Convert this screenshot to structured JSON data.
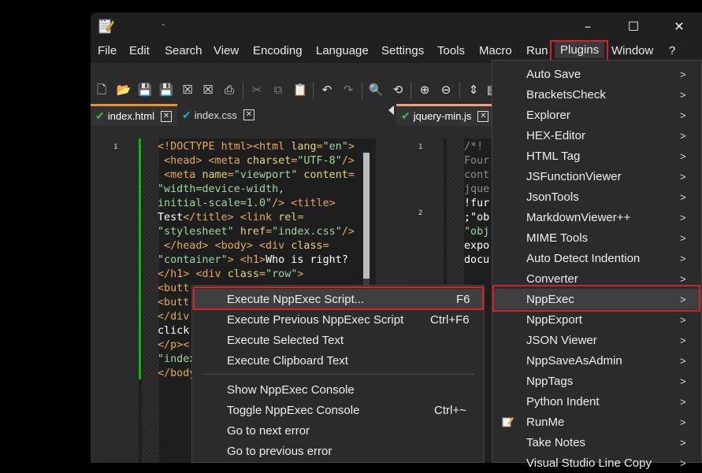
{
  "menubar": {
    "items": [
      "File",
      "Edit",
      "Search",
      "View",
      "Encoding",
      "Language",
      "Settings",
      "Tools",
      "Macro",
      "Run",
      "Plugins",
      "Window",
      "?"
    ],
    "title_fragment": "-"
  },
  "window_controls": {
    "minimize": "–",
    "maximize": "☐",
    "close": "✕"
  },
  "tabs_left": [
    {
      "label": "index.html",
      "active": true
    },
    {
      "label": "index.css",
      "active": false
    }
  ],
  "tabs_right": [
    {
      "label": "jquery-min.js",
      "active": true
    }
  ],
  "editor_left": {
    "line_numbers": [
      "1"
    ]
  },
  "editor_right": {
    "line_numbers": [
      "1",
      "2"
    ]
  },
  "plugins_menu": {
    "items": [
      {
        "label": "Auto Save",
        "submenu": true
      },
      {
        "label": "BracketsCheck",
        "submenu": true
      },
      {
        "label": "Explorer",
        "submenu": true
      },
      {
        "label": "HEX-Editor",
        "submenu": true
      },
      {
        "label": "HTML Tag",
        "submenu": true
      },
      {
        "label": "JSFunctionViewer",
        "submenu": true
      },
      {
        "label": "JsonTools",
        "submenu": true
      },
      {
        "label": "MarkdownViewer++",
        "submenu": true
      },
      {
        "label": "MIME Tools",
        "submenu": true
      },
      {
        "label": "Auto Detect Indention",
        "submenu": true
      },
      {
        "label": "Converter",
        "submenu": true
      },
      {
        "label": "NppExec",
        "submenu": true,
        "highlighted": true
      },
      {
        "label": "NppExport",
        "submenu": true
      },
      {
        "label": "JSON Viewer",
        "submenu": true
      },
      {
        "label": "NppSaveAsAdmin",
        "submenu": true
      },
      {
        "label": "NppTags",
        "submenu": true
      },
      {
        "label": "Python Indent",
        "submenu": true
      },
      {
        "label": "RunMe",
        "submenu": true,
        "icon": true
      },
      {
        "label": "Take Notes",
        "submenu": true
      },
      {
        "label": "Visual Studio Line Copy",
        "submenu": true
      }
    ]
  },
  "nppexec_menu": {
    "items": [
      {
        "label": "Execute NppExec Script...",
        "shortcut": "F6",
        "highlighted": true
      },
      {
        "label": "Execute Previous NppExec Script",
        "shortcut": "Ctrl+F6"
      },
      {
        "label": "Execute Selected Text",
        "shortcut": ""
      },
      {
        "label": "Execute Clipboard Text",
        "shortcut": ""
      },
      {
        "label": "Show NppExec Console",
        "shortcut": ""
      },
      {
        "label": "Toggle NppExec Console",
        "shortcut": "Ctrl+~"
      },
      {
        "label": "Go to next error",
        "shortcut": ""
      },
      {
        "label": "Go to previous error",
        "shortcut": ""
      }
    ]
  },
  "colors": {
    "highlight_box": "#d3232a",
    "tab_accent": "#e9913a",
    "check": "#3fbf3f"
  }
}
